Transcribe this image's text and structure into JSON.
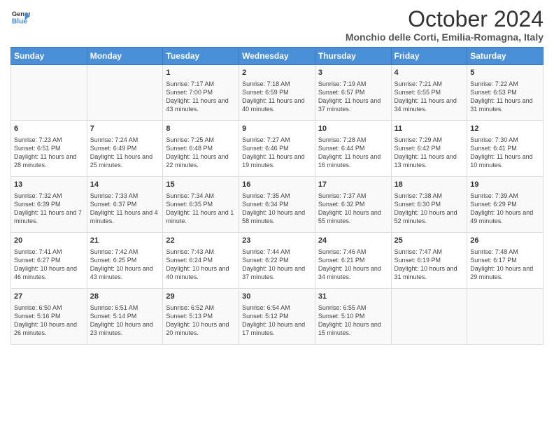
{
  "header": {
    "logo_line1": "General",
    "logo_line2": "Blue",
    "title": "October 2024",
    "subtitle": "Monchio delle Corti, Emilia-Romagna, Italy"
  },
  "columns": [
    "Sunday",
    "Monday",
    "Tuesday",
    "Wednesday",
    "Thursday",
    "Friday",
    "Saturday"
  ],
  "weeks": [
    [
      {
        "day": "",
        "info": ""
      },
      {
        "day": "",
        "info": ""
      },
      {
        "day": "1",
        "info": "Sunrise: 7:17 AM\nSunset: 7:00 PM\nDaylight: 11 hours and 43 minutes."
      },
      {
        "day": "2",
        "info": "Sunrise: 7:18 AM\nSunset: 6:59 PM\nDaylight: 11 hours and 40 minutes."
      },
      {
        "day": "3",
        "info": "Sunrise: 7:19 AM\nSunset: 6:57 PM\nDaylight: 11 hours and 37 minutes."
      },
      {
        "day": "4",
        "info": "Sunrise: 7:21 AM\nSunset: 6:55 PM\nDaylight: 11 hours and 34 minutes."
      },
      {
        "day": "5",
        "info": "Sunrise: 7:22 AM\nSunset: 6:53 PM\nDaylight: 11 hours and 31 minutes."
      }
    ],
    [
      {
        "day": "6",
        "info": "Sunrise: 7:23 AM\nSunset: 6:51 PM\nDaylight: 11 hours and 28 minutes."
      },
      {
        "day": "7",
        "info": "Sunrise: 7:24 AM\nSunset: 6:49 PM\nDaylight: 11 hours and 25 minutes."
      },
      {
        "day": "8",
        "info": "Sunrise: 7:25 AM\nSunset: 6:48 PM\nDaylight: 11 hours and 22 minutes."
      },
      {
        "day": "9",
        "info": "Sunrise: 7:27 AM\nSunset: 6:46 PM\nDaylight: 11 hours and 19 minutes."
      },
      {
        "day": "10",
        "info": "Sunrise: 7:28 AM\nSunset: 6:44 PM\nDaylight: 11 hours and 16 minutes."
      },
      {
        "day": "11",
        "info": "Sunrise: 7:29 AM\nSunset: 6:42 PM\nDaylight: 11 hours and 13 minutes."
      },
      {
        "day": "12",
        "info": "Sunrise: 7:30 AM\nSunset: 6:41 PM\nDaylight: 11 hours and 10 minutes."
      }
    ],
    [
      {
        "day": "13",
        "info": "Sunrise: 7:32 AM\nSunset: 6:39 PM\nDaylight: 11 hours and 7 minutes."
      },
      {
        "day": "14",
        "info": "Sunrise: 7:33 AM\nSunset: 6:37 PM\nDaylight: 11 hours and 4 minutes."
      },
      {
        "day": "15",
        "info": "Sunrise: 7:34 AM\nSunset: 6:35 PM\nDaylight: 11 hours and 1 minute."
      },
      {
        "day": "16",
        "info": "Sunrise: 7:35 AM\nSunset: 6:34 PM\nDaylight: 10 hours and 58 minutes."
      },
      {
        "day": "17",
        "info": "Sunrise: 7:37 AM\nSunset: 6:32 PM\nDaylight: 10 hours and 55 minutes."
      },
      {
        "day": "18",
        "info": "Sunrise: 7:38 AM\nSunset: 6:30 PM\nDaylight: 10 hours and 52 minutes."
      },
      {
        "day": "19",
        "info": "Sunrise: 7:39 AM\nSunset: 6:29 PM\nDaylight: 10 hours and 49 minutes."
      }
    ],
    [
      {
        "day": "20",
        "info": "Sunrise: 7:41 AM\nSunset: 6:27 PM\nDaylight: 10 hours and 46 minutes."
      },
      {
        "day": "21",
        "info": "Sunrise: 7:42 AM\nSunset: 6:25 PM\nDaylight: 10 hours and 43 minutes."
      },
      {
        "day": "22",
        "info": "Sunrise: 7:43 AM\nSunset: 6:24 PM\nDaylight: 10 hours and 40 minutes."
      },
      {
        "day": "23",
        "info": "Sunrise: 7:44 AM\nSunset: 6:22 PM\nDaylight: 10 hours and 37 minutes."
      },
      {
        "day": "24",
        "info": "Sunrise: 7:46 AM\nSunset: 6:21 PM\nDaylight: 10 hours and 34 minutes."
      },
      {
        "day": "25",
        "info": "Sunrise: 7:47 AM\nSunset: 6:19 PM\nDaylight: 10 hours and 31 minutes."
      },
      {
        "day": "26",
        "info": "Sunrise: 7:48 AM\nSunset: 6:17 PM\nDaylight: 10 hours and 29 minutes."
      }
    ],
    [
      {
        "day": "27",
        "info": "Sunrise: 6:50 AM\nSunset: 5:16 PM\nDaylight: 10 hours and 26 minutes."
      },
      {
        "day": "28",
        "info": "Sunrise: 6:51 AM\nSunset: 5:14 PM\nDaylight: 10 hours and 23 minutes."
      },
      {
        "day": "29",
        "info": "Sunrise: 6:52 AM\nSunset: 5:13 PM\nDaylight: 10 hours and 20 minutes."
      },
      {
        "day": "30",
        "info": "Sunrise: 6:54 AM\nSunset: 5:12 PM\nDaylight: 10 hours and 17 minutes."
      },
      {
        "day": "31",
        "info": "Sunrise: 6:55 AM\nSunset: 5:10 PM\nDaylight: 10 hours and 15 minutes."
      },
      {
        "day": "",
        "info": ""
      },
      {
        "day": "",
        "info": ""
      }
    ]
  ]
}
